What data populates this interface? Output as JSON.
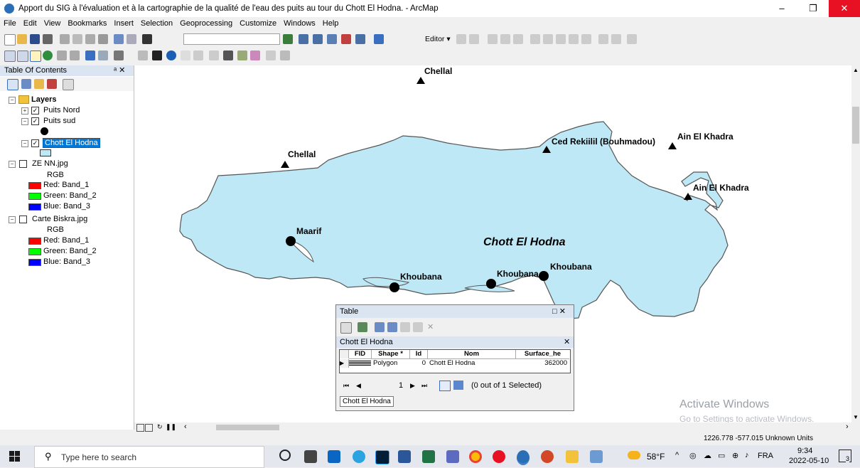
{
  "window": {
    "title": "Apport du SIG à l'évaluation et à la cartographie de la qualité de l'eau des puits au tour du Chott El Hodna. - ArcMap",
    "controls": {
      "minimize": "–",
      "maximize": "❐",
      "close": "✕"
    }
  },
  "menu": [
    "File",
    "Edit",
    "View",
    "Bookmarks",
    "Insert",
    "Selection",
    "Geoprocessing",
    "Customize",
    "Windows",
    "Help"
  ],
  "editor_label": "Editor ▾",
  "toc": {
    "title": "Table Of Contents",
    "pin": "ᵃ ✕",
    "layers_label": "Layers",
    "items": [
      {
        "name": "Puits Nord",
        "checked": true
      },
      {
        "name": "Puits sud",
        "checked": true
      },
      {
        "name": "Chott El Hodna",
        "checked": true,
        "selected": true
      },
      {
        "name": "ZE NN.jpg",
        "checked": false,
        "rgb": "RGB",
        "bands": [
          "Red:   Band_1",
          "Green: Band_2",
          "Blue:   Band_3"
        ]
      },
      {
        "name": "Carte Biskra.jpg",
        "checked": false,
        "rgb": "RGB",
        "bands": [
          "Red:   Band_1",
          "Green: Band_2",
          "Blue:   Band_3"
        ]
      }
    ]
  },
  "map": {
    "lake_label": "Chott El Hodna",
    "lake_color": "#bee8f5",
    "triangles": [
      "Chellal",
      "Chellal",
      "Ced Rekiilil (Bouhmadou)",
      "Ain El Khadra",
      "Ain El Khadra"
    ],
    "circles": [
      "Maarif",
      "Khoubana",
      "Khoubana",
      "Khoubana"
    ]
  },
  "table_window": {
    "title": "Table",
    "close": "□ ✕",
    "layer_tab_title": "Chott El Hodna",
    "columns": [
      "FID",
      "Shape *",
      "Id",
      "Nom",
      "Surface_he"
    ],
    "rows": [
      {
        "fid": "",
        "shape": "Polygon",
        "id": "0",
        "nom": "Chott El Hodna",
        "surface": "362000"
      }
    ],
    "record_number": "1",
    "selection_status": "(0 out of 1 Selected)",
    "bottom_tab": "Chott El Hodna"
  },
  "watermark": {
    "line1": "Activate Windows",
    "line2": "Go to Settings to activate Windows."
  },
  "status": {
    "coords": "1226.778  -577.015 Unknown Units"
  },
  "taskbar": {
    "search_placeholder": "Type here to search",
    "weather": "58°F",
    "lang": "FRA",
    "time": "9:34",
    "date": "2022-05-10",
    "notif_count": "3"
  }
}
